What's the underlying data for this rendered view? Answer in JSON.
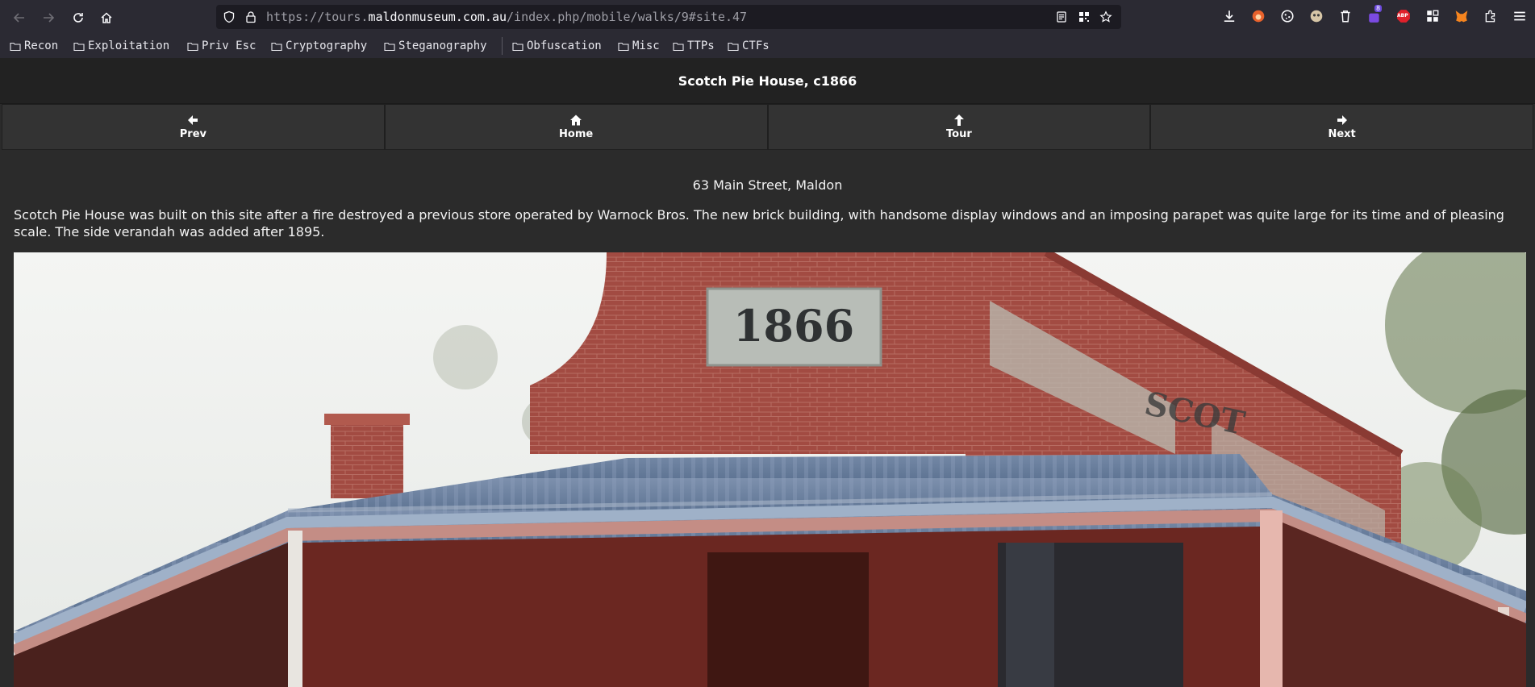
{
  "browser": {
    "url_prefix": "https://tours.",
    "url_host": "maldonmuseum.com.au",
    "url_path": "/index.php/mobile/walks/9#site.47",
    "extension_badge": "8",
    "adblock_label": "ABP"
  },
  "bookmarks": [
    {
      "label": "Recon"
    },
    {
      "label": "Exploitation"
    },
    {
      "label": "Priv Esc"
    },
    {
      "label": "Cryptography"
    },
    {
      "label": "Steganography"
    },
    {
      "label": "Obfuscation"
    },
    {
      "label": "Misc"
    },
    {
      "label": "TTPs"
    },
    {
      "label": "CTFs"
    }
  ],
  "page": {
    "title": "Scotch Pie House, c1866",
    "nav": [
      {
        "label": "Prev",
        "icon": "arrow-left-icon"
      },
      {
        "label": "Home",
        "icon": "home-icon"
      },
      {
        "label": "Tour",
        "icon": "arrow-up-icon"
      },
      {
        "label": "Next",
        "icon": "arrow-right-icon"
      }
    ],
    "address": "63 Main Street, Maldon",
    "description": "Scotch Pie House was built on this site after a fire destroyed a previous store operated by Warnock Bros. The new brick building, with handsome display windows and an imposing parapet was quite large for its time and of pleasing scale. The side verandah was added after 1895.",
    "photo": {
      "year_plaque": "1866",
      "faded_sign": "SCOT"
    }
  },
  "colors": {
    "page_bg": "#2b2b2b",
    "header_bg": "#222222",
    "nav_bg": "#333333",
    "chrome_bg": "#2b2a33",
    "urlbar_bg": "#1c1b22"
  }
}
